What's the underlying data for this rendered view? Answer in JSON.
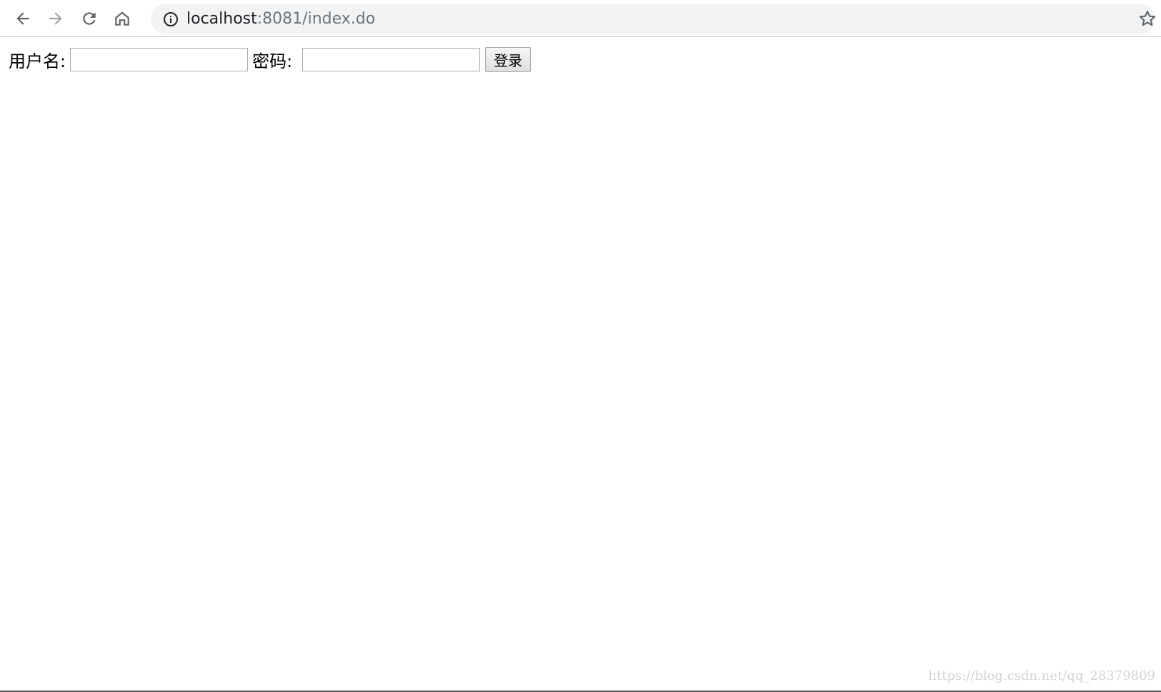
{
  "browser": {
    "url_host": "localhost",
    "url_path": ":8081/index.do",
    "icons": {
      "back": "arrow-left-icon",
      "forward": "arrow-right-icon",
      "reload": "reload-icon",
      "home": "home-icon",
      "site_info": "info-icon",
      "bookmark": "star-icon"
    },
    "forward_disabled": true
  },
  "form": {
    "username_label": "用户名:",
    "username_value": "",
    "password_label": "密码:",
    "password_value": "",
    "login_label": "登录"
  },
  "watermark": "https://blog.csdn.net/qq_28379809",
  "colors": {
    "toolbar_bg": "#ffffff",
    "omnibox_bg": "#f1f3f4",
    "icon": "#5f6368",
    "icon_disabled": "#a0a0a0",
    "url_host": "#202124",
    "url_path": "#70757a"
  }
}
